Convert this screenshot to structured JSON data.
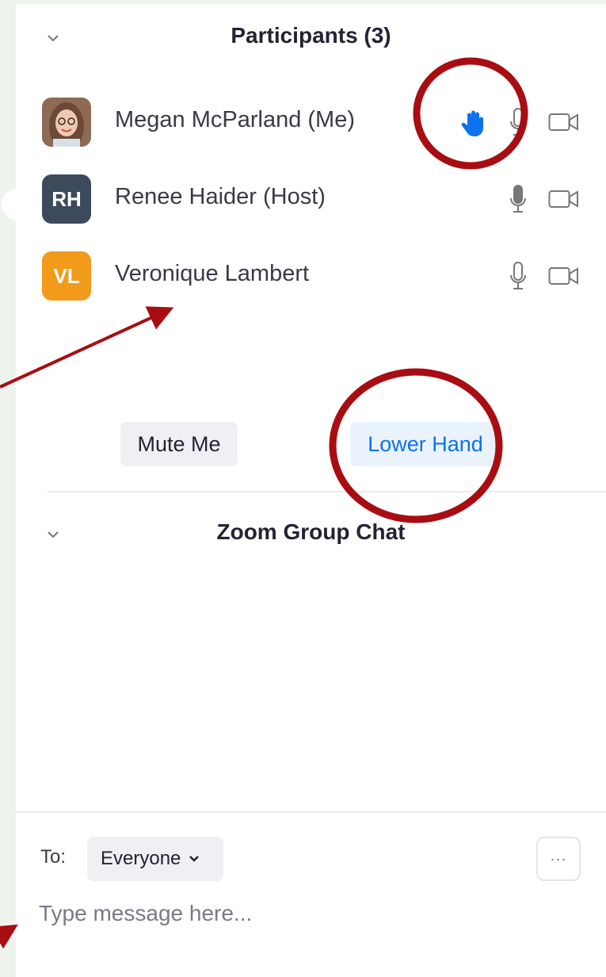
{
  "participants": {
    "title": "Participants (3)",
    "list": [
      {
        "name": "Megan McParland (Me)",
        "initials": "",
        "avatar_type": "photo",
        "hand_raised": true,
        "mic": "on",
        "video": "off"
      },
      {
        "name": "Renee Haider (Host)",
        "initials": "RH",
        "avatar_color": "#3d4a5c",
        "hand_raised": false,
        "mic": "active",
        "video": "off"
      },
      {
        "name": "Veronique Lambert",
        "initials": "VL",
        "avatar_color": "#f29a1a",
        "hand_raised": false,
        "mic": "on",
        "video": "off"
      }
    ],
    "mute_me_label": "Mute Me",
    "lower_hand_label": "Lower Hand"
  },
  "chat": {
    "title": "Zoom Group Chat",
    "to_label": "To:",
    "to_value": "Everyone",
    "more_label": "···",
    "placeholder": "Type message here..."
  },
  "colors": {
    "hand": "#0e72ed",
    "lower_hand_bg": "#e9f2fd",
    "lower_hand_text": "#0e72ed",
    "annotation": "#a80d12"
  }
}
